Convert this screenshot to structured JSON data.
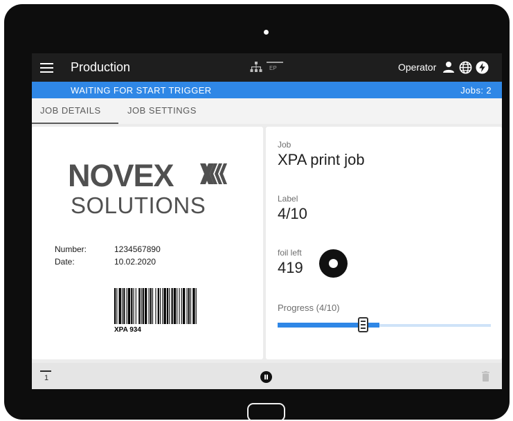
{
  "app": {
    "title": "Production",
    "ep_label": "EP",
    "operator": "Operator",
    "icons": [
      "menu-icon",
      "network-icon",
      "ep-icon",
      "user-icon",
      "globe-icon",
      "power-icon"
    ]
  },
  "status": {
    "message": "WAITING FOR START TRIGGER",
    "jobs": "Jobs: 2"
  },
  "tabs": [
    {
      "label": "JOB DETAILS",
      "active": true
    },
    {
      "label": "JOB SETTINGS",
      "active": false
    }
  ],
  "label_preview": {
    "logo_line1": "NOVEX",
    "logo_line2": "SOLUTIONS",
    "fields": [
      {
        "label": "Number:",
        "value": "1234567890"
      },
      {
        "label": "Date:",
        "value": "10.02.2020"
      }
    ],
    "barcode_text": "XPA 934"
  },
  "job_info": {
    "job_label": "Job",
    "job_value": "XPA print job",
    "label_label": "Label",
    "label_value": "4/10",
    "foil_label": "foil left",
    "foil_value": "419",
    "progress_label": "Progress (4/10)",
    "progress_fraction": 0.4
  },
  "bottom": {
    "counter": "1",
    "icons": [
      "counter-icon",
      "pause-icon",
      "trash-icon"
    ]
  },
  "colors": {
    "appbar": "#1e1e1e",
    "accent": "#2f87e6",
    "background": "#ececec",
    "device": "#0d0d0d"
  }
}
